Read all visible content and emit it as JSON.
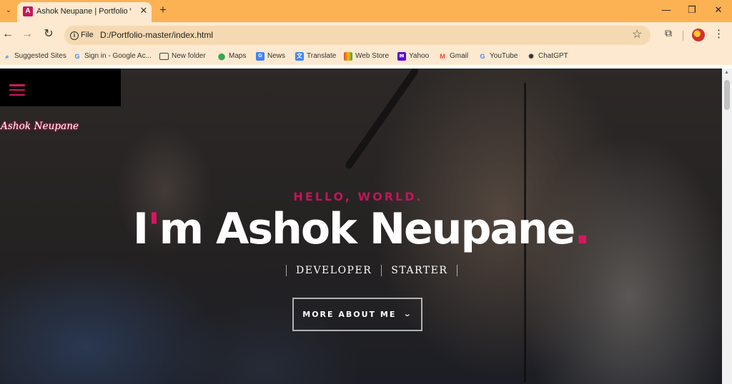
{
  "browser": {
    "tab": {
      "title": "Ashok Neupane | Portfolio Web",
      "favicon_letter": "A",
      "close": "✕"
    },
    "tab_list": "⌄",
    "new_tab": "+",
    "window": {
      "minimize": "—",
      "restore": "❐",
      "close": "✕"
    },
    "nav": {
      "back": "←",
      "forward": "→",
      "reload": "↻"
    },
    "address": {
      "chip": "File",
      "url": "D:/Portfolio-master/index.html"
    },
    "bookmarks": [
      {
        "label": "Suggested Sites",
        "icon": "search-icon"
      },
      {
        "label": "Sign in - Google Ac...",
        "icon": "google-icon"
      },
      {
        "label": "New folder",
        "icon": "folder-icon"
      },
      {
        "label": "Maps",
        "icon": "maps-icon"
      },
      {
        "label": "News",
        "icon": "news-icon"
      },
      {
        "label": "Translate",
        "icon": "translate-icon"
      },
      {
        "label": "Web Store",
        "icon": "webstore-icon"
      },
      {
        "label": "Yahoo",
        "icon": "yahoo-icon"
      },
      {
        "label": "Gmail",
        "icon": "gmail-icon"
      },
      {
        "label": "YouTube",
        "icon": "google-icon"
      },
      {
        "label": "ChatGPT",
        "icon": "chatgpt-icon"
      }
    ]
  },
  "page": {
    "logo": "Ashok Neupane",
    "intro": {
      "kicker": "HELLO, WORLD.",
      "title_prefix": "I'm Ashok Neupane",
      "title_dot": ".",
      "roles": [
        "DEVELOPER",
        "STARTER"
      ]
    },
    "cta": {
      "label": "MORE ABOUT ME",
      "icon": "chevron-down-icon"
    }
  },
  "colors": {
    "accent": "#d6175e",
    "chrome": "#fcb253",
    "toolbar": "#fde9cf"
  }
}
